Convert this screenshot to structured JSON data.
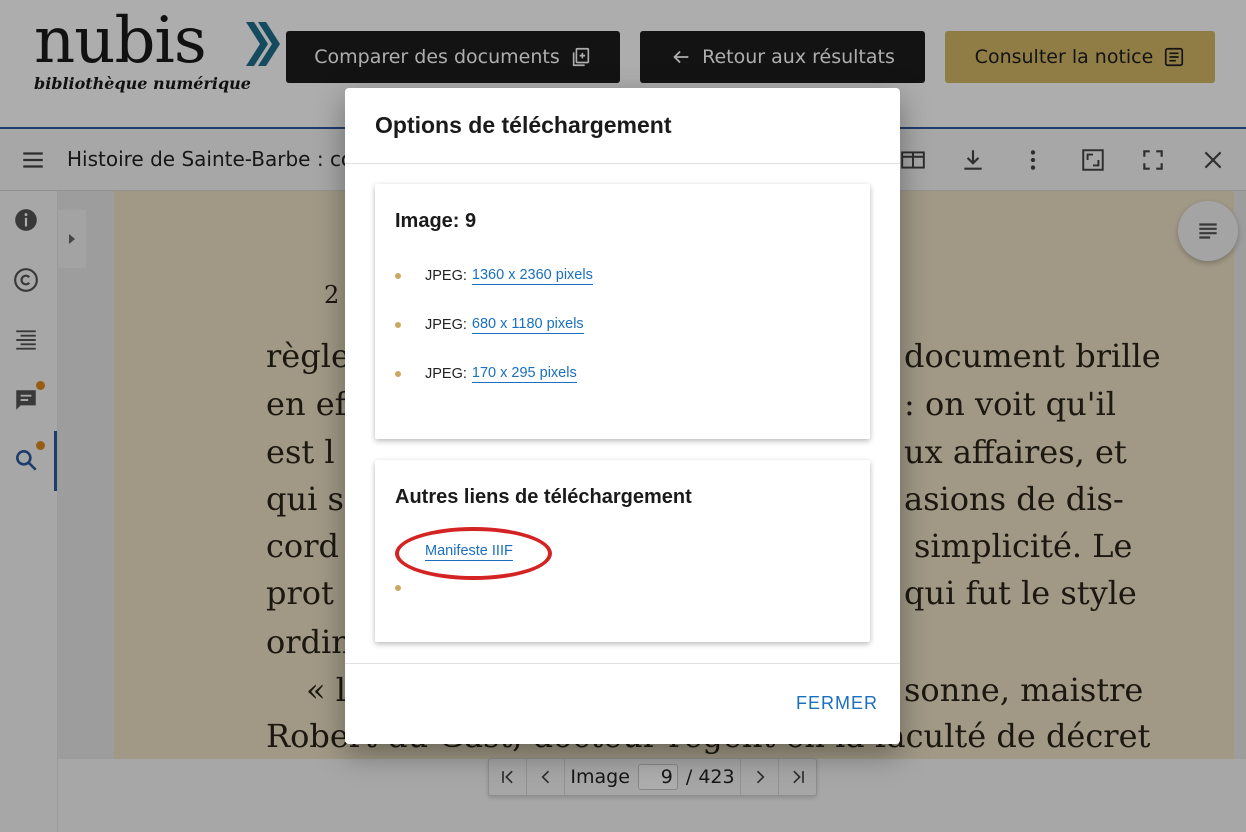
{
  "header": {
    "logo_text": "nubis",
    "logo_subtitle": "bibliothèque numérique",
    "btn_compare": "Comparer des documents",
    "btn_back": "Retour aux résultats",
    "btn_notice": "Consulter la notice",
    "accent_color": "#d4b866"
  },
  "viewer": {
    "doc_title": "Histoire de Sainte-Barbe : co",
    "scan": {
      "page_number": "2",
      "lines": [
        "règle",
        "en ef",
        "est l",
        "qui s",
        "cord",
        "prot",
        "ordin",
        "« l",
        "Robert du Gast, docteur régent en la faculté de décret",
        "document brille",
        ": on voit qu'il",
        "ux affaires, et",
        "asions de dis-",
        "simplicité. Le",
        "qui fut le style",
        "sonne, maistre"
      ]
    },
    "pager": {
      "label": "Image",
      "current": "9",
      "total": "/ 423"
    }
  },
  "modal": {
    "title": "Options de téléchargement",
    "image_card": {
      "title": "Image: 9",
      "items": [
        {
          "format": "JPEG:",
          "link": "1360 x 2360 pixels"
        },
        {
          "format": "JPEG:",
          "link": "680 x 1180 pixels"
        },
        {
          "format": "JPEG:",
          "link": "170 x 295 pixels"
        }
      ]
    },
    "other_card": {
      "title": "Autres liens de téléchargement",
      "link": "Manifeste IIIF"
    },
    "close_label": "FERMER"
  }
}
